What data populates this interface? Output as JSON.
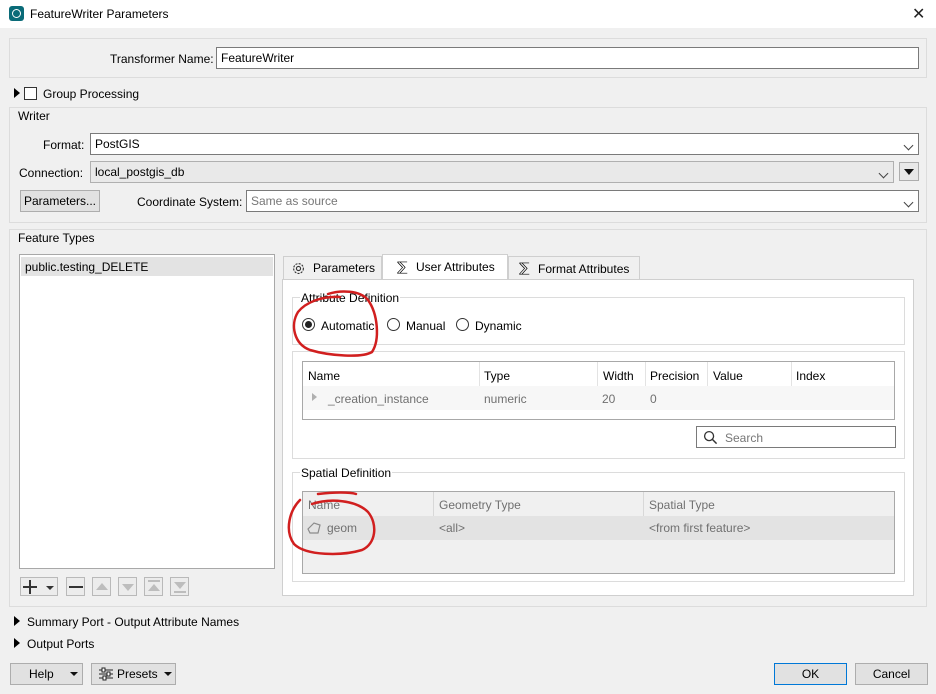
{
  "window": {
    "title": "FeatureWriter Parameters",
    "close_glyph": "✕"
  },
  "transformer": {
    "label": "Transformer Name:",
    "value": "FeatureWriter"
  },
  "group_processing": {
    "label": "Group Processing"
  },
  "writer": {
    "section_label": "Writer",
    "format_label": "Format:",
    "format_value": "PostGIS",
    "connection_label": "Connection:",
    "connection_value": "local_postgis_db",
    "parameters_button": "Parameters...",
    "coord_label": "Coordinate System:",
    "coord_placeholder": "Same as source"
  },
  "feature_types": {
    "section_label": "Feature Types",
    "items": [
      "public.testing_DELETE"
    ],
    "tabs": [
      {
        "label": "Parameters",
        "icon": "gear-icon"
      },
      {
        "label": "User Attributes",
        "icon": "sigma-icon"
      },
      {
        "label": "Format Attributes",
        "icon": "sigma-icon"
      }
    ],
    "active_tab": "User Attributes"
  },
  "attribute_definition": {
    "label": "Attribute Definition",
    "options": [
      "Automatic",
      "Manual",
      "Dynamic"
    ],
    "selected": "Automatic",
    "columns": [
      "Name",
      "Type",
      "Width",
      "Precision",
      "Value",
      "Index"
    ],
    "rows": [
      {
        "name": "_creation_instance",
        "type": "numeric",
        "width": "20",
        "precision": "0",
        "value": "",
        "index": ""
      }
    ],
    "search_placeholder": "Search"
  },
  "spatial_definition": {
    "label": "Spatial Definition",
    "columns": [
      "Name",
      "Geometry Type",
      "Spatial Type"
    ],
    "rows": [
      {
        "name": "geom",
        "geometry_type": "<all>",
        "spatial_type": "<from first feature>"
      }
    ]
  },
  "collapsibles": {
    "summary_port": "Summary Port - Output Attribute Names",
    "output_ports": "Output Ports"
  },
  "footer": {
    "help": "Help",
    "presets": "Presets",
    "ok": "OK",
    "cancel": "Cancel"
  },
  "colors": {
    "accent": "#0078d7",
    "annotation": "#d11f1f",
    "app_icon": "#0a6b78"
  }
}
